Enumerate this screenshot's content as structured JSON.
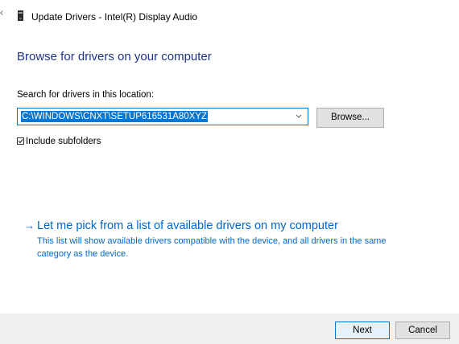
{
  "window": {
    "title": "Update Drivers - Intel(R) Display Audio"
  },
  "page": {
    "heading": "Browse for drivers on your computer",
    "search_label": "Search for drivers in this location:",
    "path_value": "C:\\WINDOWS\\CNXT\\SETUP616531A80XYZ",
    "browse_label": "Browse...",
    "include_subfolders_label": "Include subfolders",
    "include_subfolders_checked": true
  },
  "pick_option": {
    "arrow": "→",
    "title": "Let me pick from a list of available drivers on my computer",
    "description": "This list will show available drivers compatible with the device, and all drivers in the same category as the device."
  },
  "footer": {
    "next_label": "Next",
    "cancel_label": "Cancel"
  },
  "icons": {
    "title_icon": "device-icon",
    "combo_arrow": "chevron-down-icon",
    "check": "checkmark-icon",
    "back": "back-arrow-icon"
  },
  "colors": {
    "heading": "#1e3287",
    "link": "#0066cc",
    "selection": "#0078d7",
    "footer_bg": "#f0f0f0",
    "button_bg": "#e1e1e1"
  }
}
